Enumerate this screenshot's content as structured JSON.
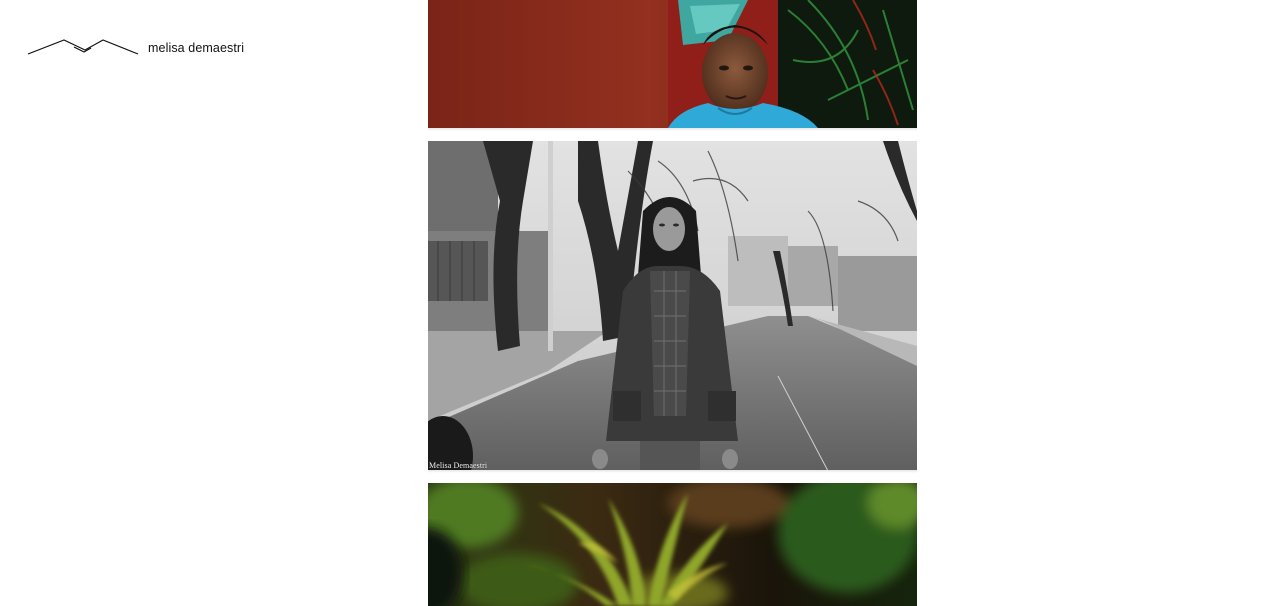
{
  "site": {
    "logo_icon": "mountain-logo-icon",
    "name": "melisa demaestri"
  },
  "photos": [
    {
      "subject": "man in blue t-shirt against red wall and plants",
      "tone": "color",
      "colors": {
        "wall": "#8a2a1c",
        "shirt": "#2ea9d8",
        "foliage": "#1d5a22"
      }
    },
    {
      "subject": "woman in jacket standing on tree-lined street",
      "tone": "black-and-white",
      "watermark": "Melisa Demaestri"
    },
    {
      "subject": "palm leaves and greenery",
      "tone": "color",
      "colors": {
        "foliage": "#6a8a1e",
        "shadow": "#1b1a0d"
      }
    }
  ]
}
